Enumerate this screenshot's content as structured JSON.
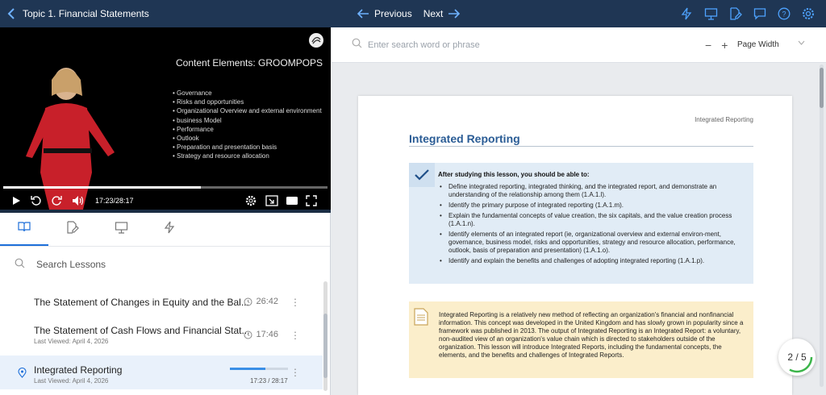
{
  "topbar": {
    "title": "Topic 1. Financial Statements",
    "previous_label": "Previous",
    "next_label": "Next",
    "icons": [
      "back-chevron-icon",
      "flash-icon",
      "presentation-icon",
      "edit-note-icon",
      "comment-icon",
      "help-icon",
      "settings-icon"
    ]
  },
  "video": {
    "heading": "Content Elements:   GROOMPOPS",
    "elements": [
      "Governance",
      "Risks and opportunities",
      "Organizational Overview and external environment",
      "business Model",
      "Performance",
      "Outlook",
      "Preparation and presentation basis",
      "Strategy and resource allocation"
    ],
    "time": "17:23/28:17",
    "progress_percent": 61
  },
  "lessons_panel": {
    "search_placeholder": "Search Lessons",
    "lessons": [
      {
        "title": "The Statement of Changes in Equity and the Bal...",
        "duration": "26:42",
        "last_viewed": ""
      },
      {
        "title": "The Statement of Cash Flows and Financial Stat...",
        "duration": "17:46",
        "last_viewed": "Last Viewed: April 4, 2026"
      },
      {
        "title": "Integrated Reporting",
        "duration": "17:23 / 28:17",
        "last_viewed": "Last Viewed: April 4, 2026"
      }
    ]
  },
  "viewer": {
    "search_placeholder": "Enter search word or phrase",
    "zoom_minus": "−",
    "zoom_plus": "+",
    "page_width_label": "Page Width",
    "page_header": "Integrated Reporting",
    "page_title": "Integrated Reporting",
    "objectives_lead": "After studying this lesson, you should be able to:",
    "objectives": [
      "Define integrated reporting, integrated thinking, and the integrated report, and demonstrate an understanding of the relationship among them (1.A.1.l).",
      "Identify the primary purpose of integrated reporting (1.A.1.m).",
      "Explain the fundamental concepts of value creation, the six capitals, and the value creation process (1.A.1.n).",
      "Identify elements of an integrated report (ie, organizational overview and external environ-ment, governance, business model, risks and opportunities, strategy and resource allocation, performance, outlook, basis of preparation and presentation) (1.A.1.o).",
      "Identify and explain the benefits and challenges of adopting integrated reporting (1.A.1.p)."
    ],
    "note": "Integrated Reporting is a relatively new method of reflecting an organization's financial and nonfinancial information. This concept was developed in the United Kingdom and has slowly grown in popularity since a framework was published in 2013. The output of Integrated Reporting is an Integrated Report: a voluntary, non-audited view of an organization's value chain which is directed to stakeholders outside of the organization. This lesson will introduce Integrated Reports, including the fundamental concepts, the elements, and the benefits and challenges of Integrated Reports.",
    "page_indicator": "2 / 5"
  },
  "colors": {
    "topbar": "#1f3654",
    "accent": "#1e6fd9",
    "title_blue": "#2a5c95"
  }
}
